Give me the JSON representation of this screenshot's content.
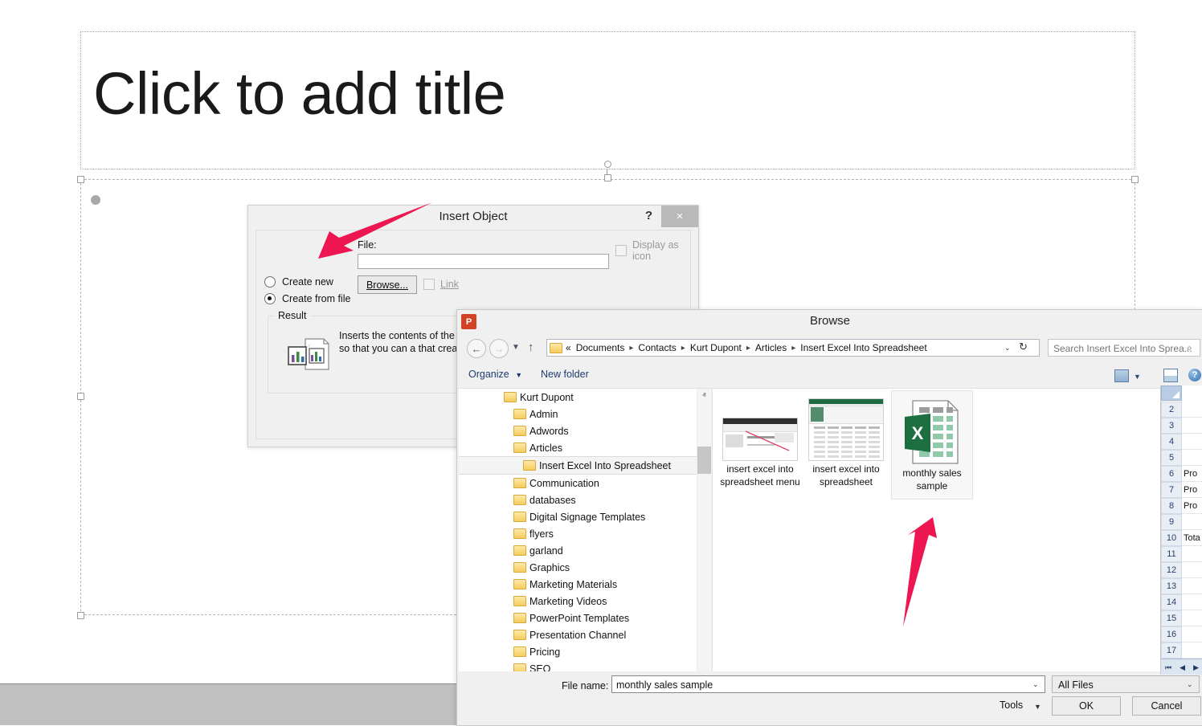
{
  "slide": {
    "title_placeholder": "Click to add title"
  },
  "insert_object": {
    "title": "Insert Object",
    "help_label": "?",
    "close_label": "×",
    "create_new_label": "Create new",
    "create_from_file_label": "Create from file",
    "file_label": "File:",
    "file_value": "",
    "browse_label": "Browse...",
    "link_label": "Link",
    "display_as_icon_label": "Display as icon",
    "result_legend": "Result",
    "result_text": "Inserts the contents of the file presentation so that you can a that created it."
  },
  "browse": {
    "title": "Browse",
    "app_icon_label": "P",
    "nav": {
      "back": "←",
      "forward": "→",
      "recent": "▼",
      "up": "↑"
    },
    "breadcrumb": {
      "prefix": "«",
      "items": [
        "Documents",
        "Contacts",
        "Kurt Dupont",
        "Articles",
        "Insert Excel Into Spreadsheet"
      ],
      "separator": "▸",
      "dropdown": "⌄",
      "refresh": "↻"
    },
    "search": {
      "placeholder": "Search Insert Excel Into Sprea...",
      "icon": "⌕"
    },
    "toolbar": {
      "organize_label": "Organize",
      "organize_caret": "▼",
      "new_folder_label": "New folder",
      "view_caret": "▼",
      "help_label": "?"
    },
    "tree": [
      {
        "label": "Kurt Dupont",
        "indent": 56,
        "selected": false
      },
      {
        "label": "Admin",
        "indent": 68,
        "selected": false
      },
      {
        "label": "Adwords",
        "indent": 68,
        "selected": false
      },
      {
        "label": "Articles",
        "indent": 68,
        "selected": false
      },
      {
        "label": "Insert Excel Into Spreadsheet",
        "indent": 80,
        "selected": true
      },
      {
        "label": "Communication",
        "indent": 68,
        "selected": false
      },
      {
        "label": "databases",
        "indent": 68,
        "selected": false
      },
      {
        "label": "Digital Signage Templates",
        "indent": 68,
        "selected": false
      },
      {
        "label": "flyers",
        "indent": 68,
        "selected": false
      },
      {
        "label": "garland",
        "indent": 68,
        "selected": false
      },
      {
        "label": "Graphics",
        "indent": 68,
        "selected": false
      },
      {
        "label": "Marketing Materials",
        "indent": 68,
        "selected": false
      },
      {
        "label": "Marketing Videos",
        "indent": 68,
        "selected": false
      },
      {
        "label": "PowerPoint Templates",
        "indent": 68,
        "selected": false
      },
      {
        "label": "Presentation Channel",
        "indent": 68,
        "selected": false
      },
      {
        "label": "Pricing",
        "indent": 68,
        "selected": false
      },
      {
        "label": "SEO",
        "indent": 68,
        "selected": false
      }
    ],
    "scroll_up": "ⱏ",
    "scroll_down": "ⱟ",
    "files": [
      {
        "name": "insert excel into spreadsheet menu",
        "type": "powerpoint-thumbnail",
        "selected": false
      },
      {
        "name": "insert excel into spreadsheet",
        "type": "excel-thumbnail",
        "selected": false
      },
      {
        "name": "monthly sales sample",
        "type": "excel-icon",
        "selected": true
      }
    ],
    "footer": {
      "filename_label": "File name:",
      "filename_value": "monthly sales sample",
      "filetype_value": "All Files",
      "tools_label": "Tools",
      "ok_label": "OK",
      "cancel_label": "Cancel",
      "caret": "⌄"
    }
  },
  "excel_sliver": {
    "rows": [
      {
        "num": "2",
        "text": ""
      },
      {
        "num": "3",
        "text": ""
      },
      {
        "num": "4",
        "text": ""
      },
      {
        "num": "5",
        "text": ""
      },
      {
        "num": "6",
        "text": "Pro"
      },
      {
        "num": "7",
        "text": "Pro"
      },
      {
        "num": "8",
        "text": "Pro"
      },
      {
        "num": "9",
        "text": ""
      },
      {
        "num": "10",
        "text": "Tota"
      },
      {
        "num": "11",
        "text": ""
      },
      {
        "num": "12",
        "text": ""
      },
      {
        "num": "13",
        "text": ""
      },
      {
        "num": "14",
        "text": ""
      },
      {
        "num": "15",
        "text": ""
      },
      {
        "num": "16",
        "text": ""
      },
      {
        "num": "17",
        "text": ""
      }
    ],
    "nav": [
      "⏮",
      "◀",
      "▶"
    ]
  },
  "annotations": {
    "arrow_color": "#ED1651",
    "arrow_top_target": "create-from-file-radio",
    "arrow_bottom_target": "monthly-sales-sample-file"
  }
}
